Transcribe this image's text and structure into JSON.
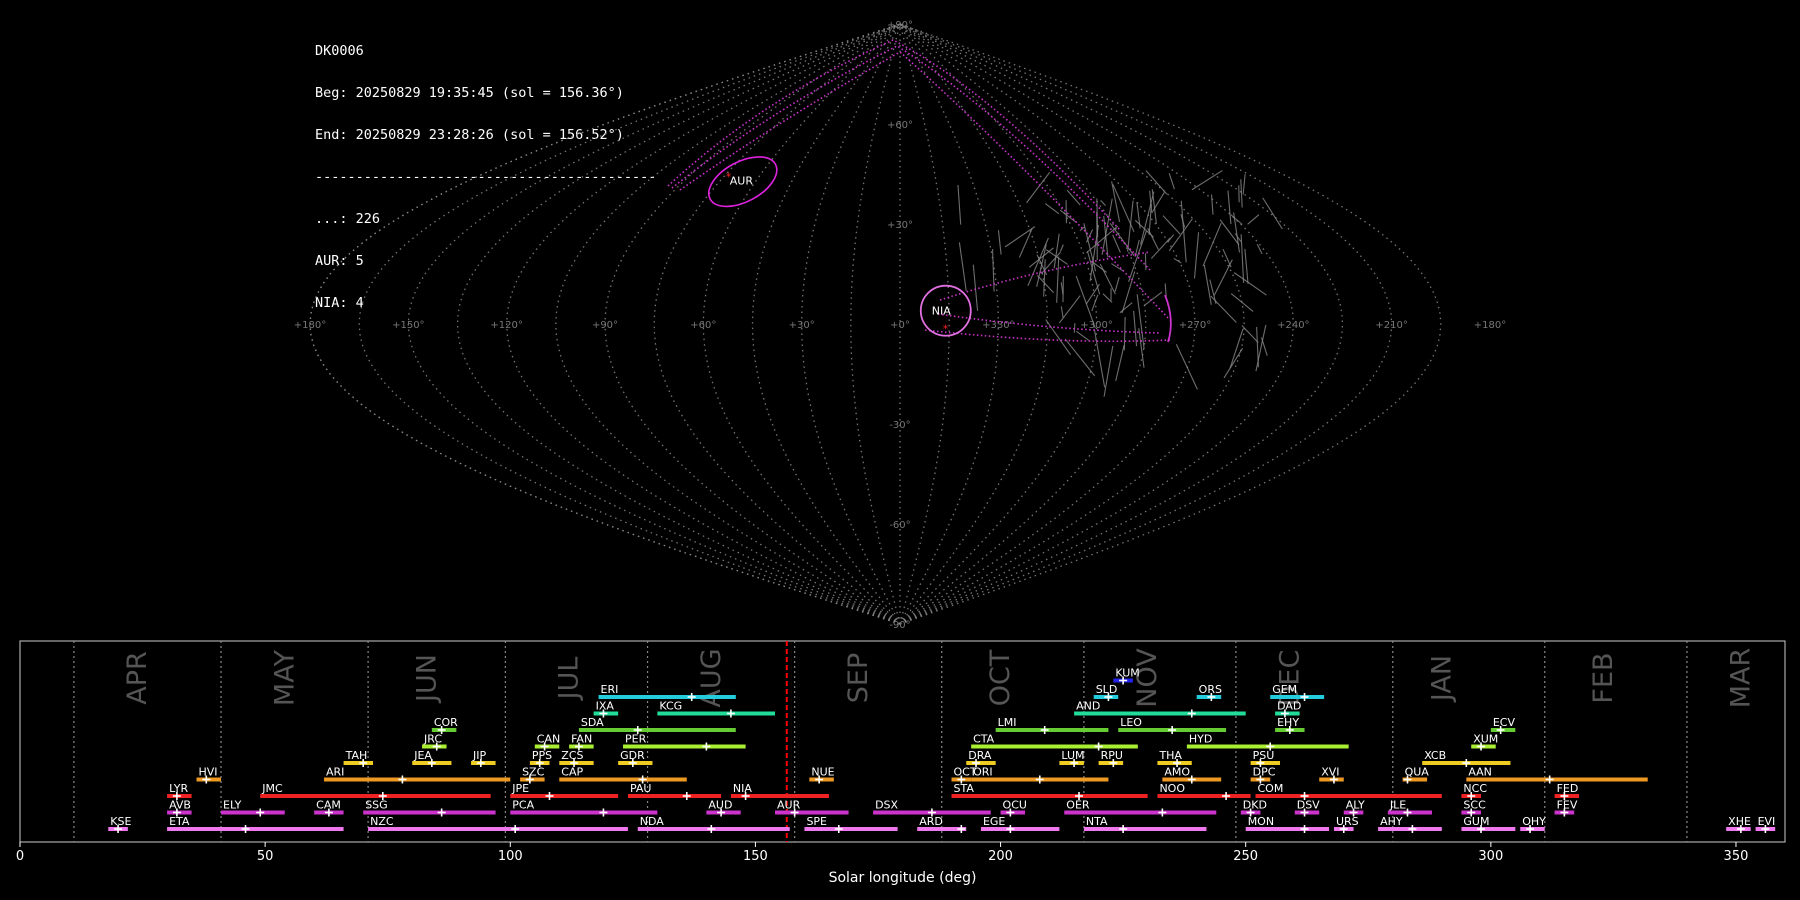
{
  "info": {
    "station": "DK0006",
    "begin": "Beg: 20250829 19:35:45 (sol = 156.36°)",
    "end": "End: 20250829 23:28:26 (sol = 156.52°)",
    "separator": "------------------------------------------",
    "counts": [
      {
        "label": "...: 226"
      },
      {
        "label": "AUR: 5"
      },
      {
        "label": "NIA: 4"
      }
    ]
  },
  "colors": {
    "background": "#000000",
    "grid": "#888888",
    "meteor_trails": "#8a8a8a",
    "shower_highlight": "#cc33cc",
    "current_sol_line": "#ff0000",
    "panel_border": "#cccccc"
  },
  "chart_data": [
    {
      "type": "scatter",
      "title": "",
      "projection": "sinusoidal sky map",
      "lat_labels": [
        "+90°",
        "+60°",
        "+30°",
        "-30°",
        "-60°",
        "-90°"
      ],
      "lon_labels": [
        "+180°",
        "+150°",
        "+120°",
        "+90°",
        "+60°",
        "+30°",
        "+0°",
        "+330°",
        "+300°",
        "+270°",
        "+240°",
        "+210°",
        "+180°"
      ],
      "radiants": [
        {
          "name": "AUR",
          "lon": 66,
          "lat": 43
        },
        {
          "name": "NIA",
          "lon": 346,
          "lat": 4
        }
      ],
      "grid": true
    },
    {
      "type": "bar",
      "title": "",
      "xlabel": "Solar longitude (deg)",
      "ylabel": "",
      "xlim": [
        0,
        360
      ],
      "xticks": [
        0,
        50,
        100,
        150,
        200,
        250,
        300,
        350
      ],
      "current_sol": 156.4,
      "grid": true,
      "months": [
        {
          "name": "APR",
          "center": 24,
          "start": 11
        },
        {
          "name": "MAY",
          "center": 54,
          "start": 41
        },
        {
          "name": "JUN",
          "center": 83,
          "start": 71
        },
        {
          "name": "JUL",
          "center": 112,
          "start": 99
        },
        {
          "name": "AUG",
          "center": 141,
          "start": 128
        },
        {
          "name": "SEP",
          "center": 171,
          "start": 158
        },
        {
          "name": "OCT",
          "center": 200,
          "start": 188
        },
        {
          "name": "NOV",
          "center": 230,
          "start": 217
        },
        {
          "name": "DEC",
          "center": 259,
          "start": 248
        },
        {
          "name": "JAN",
          "center": 290,
          "start": 280
        },
        {
          "name": "FEB",
          "center": 323,
          "start": 311
        },
        {
          "name": "MAR",
          "center": 351,
          "start": 340
        }
      ],
      "showers": [
        {
          "name": "KUM",
          "start": 223,
          "end": 227,
          "peak": 225,
          "row": 10,
          "color": "#2222ee"
        },
        {
          "name": "ERI",
          "start": 118,
          "end": 146,
          "peak": 137,
          "row": 9,
          "color": "#22ccdd"
        },
        {
          "name": "SLD",
          "start": 219,
          "end": 224,
          "peak": 222,
          "row": 9,
          "color": "#22ccdd"
        },
        {
          "name": "ORS",
          "start": 240,
          "end": 245,
          "peak": 243,
          "row": 9,
          "color": "#22ccdd"
        },
        {
          "name": "GEM",
          "start": 255,
          "end": 266,
          "peak": 262,
          "row": 9,
          "color": "#22ccdd"
        },
        {
          "name": "IXA",
          "start": 117,
          "end": 122,
          "peak": 119,
          "row": 8,
          "color": "#22dd99"
        },
        {
          "name": "KCG",
          "start": 130,
          "end": 154,
          "peak": 145,
          "row": 8,
          "color": "#22dd99"
        },
        {
          "name": "AND",
          "start": 215,
          "end": 250,
          "peak": 239,
          "row": 8,
          "color": "#22dd99"
        },
        {
          "name": "DAD",
          "start": 256,
          "end": 261,
          "peak": 258,
          "row": 8,
          "color": "#22dd99"
        },
        {
          "name": "COR",
          "start": 84,
          "end": 89,
          "peak": 86,
          "row": 7,
          "color": "#66cc33"
        },
        {
          "name": "SDA",
          "start": 114,
          "end": 146,
          "peak": 126,
          "row": 7,
          "color": "#66cc33"
        },
        {
          "name": "LMI",
          "start": 199,
          "end": 222,
          "peak": 209,
          "row": 7,
          "color": "#66cc33"
        },
        {
          "name": "LEO",
          "start": 224,
          "end": 246,
          "peak": 235,
          "row": 7,
          "color": "#66cc33"
        },
        {
          "name": "EHY",
          "start": 256,
          "end": 262,
          "peak": 259,
          "row": 7,
          "color": "#66cc33"
        },
        {
          "name": "ECV",
          "start": 300,
          "end": 305,
          "peak": 302,
          "row": 7,
          "color": "#66cc33"
        },
        {
          "name": "JRC",
          "start": 82,
          "end": 87,
          "peak": 85,
          "row": 6,
          "color": "#aaee33"
        },
        {
          "name": "CAN",
          "start": 105,
          "end": 110,
          "peak": 107,
          "row": 6,
          "color": "#aaee33"
        },
        {
          "name": "FAN",
          "start": 112,
          "end": 117,
          "peak": 114,
          "row": 6,
          "color": "#aaee33"
        },
        {
          "name": "PER",
          "start": 123,
          "end": 148,
          "peak": 140,
          "row": 6,
          "color": "#aaee33"
        },
        {
          "name": "CTA",
          "start": 194,
          "end": 228,
          "peak": 220,
          "row": 6,
          "color": "#aaee33"
        },
        {
          "name": "HYD",
          "start": 238,
          "end": 271,
          "peak": 255,
          "row": 6,
          "color": "#aaee33"
        },
        {
          "name": "XUM",
          "start": 296,
          "end": 301,
          "peak": 298,
          "row": 6,
          "color": "#aaee33"
        },
        {
          "name": "TAH",
          "start": 66,
          "end": 72,
          "peak": 70,
          "row": 5,
          "color": "#eecc22"
        },
        {
          "name": "JEA",
          "start": 80,
          "end": 88,
          "peak": 84,
          "row": 5,
          "color": "#eecc22"
        },
        {
          "name": "JIP",
          "start": 92,
          "end": 97,
          "peak": 94,
          "row": 5,
          "color": "#eecc22"
        },
        {
          "name": "PPS",
          "start": 104,
          "end": 108,
          "peak": 106,
          "row": 5,
          "color": "#eecc22"
        },
        {
          "name": "ZCS",
          "start": 110,
          "end": 117,
          "peak": 113,
          "row": 5,
          "color": "#eecc22"
        },
        {
          "name": "GDR",
          "start": 122,
          "end": 129,
          "peak": 125,
          "row": 5,
          "color": "#eecc22"
        },
        {
          "name": "DRA",
          "start": 193,
          "end": 199,
          "peak": 195,
          "row": 5,
          "color": "#eecc22"
        },
        {
          "name": "LUM",
          "start": 212,
          "end": 217,
          "peak": 215,
          "row": 5,
          "color": "#eecc22"
        },
        {
          "name": "RPU",
          "start": 220,
          "end": 225,
          "peak": 223,
          "row": 5,
          "color": "#eecc22"
        },
        {
          "name": "THA",
          "start": 232,
          "end": 239,
          "peak": 236,
          "row": 5,
          "color": "#eecc22"
        },
        {
          "name": "PSU",
          "start": 251,
          "end": 257,
          "peak": 253,
          "row": 5,
          "color": "#eecc22"
        },
        {
          "name": "XCB",
          "start": 286,
          "end": 304,
          "peak": 295,
          "row": 5,
          "color": "#eecc22"
        },
        {
          "name": "HVI",
          "start": 36,
          "end": 41,
          "peak": 38,
          "row": 4,
          "color": "#ee9922"
        },
        {
          "name": "ARI",
          "start": 62,
          "end": 100,
          "peak": 78,
          "row": 4,
          "color": "#ee9922"
        },
        {
          "name": "SZC",
          "start": 102,
          "end": 107,
          "peak": 104,
          "row": 4,
          "color": "#ee9922"
        },
        {
          "name": "CAP",
          "start": 110,
          "end": 136,
          "peak": 127,
          "row": 4,
          "color": "#ee9922"
        },
        {
          "name": "NUE",
          "start": 161,
          "end": 166,
          "peak": 163,
          "row": 4,
          "color": "#ee9922"
        },
        {
          "name": "OCT",
          "start": 190,
          "end": 194,
          "peak": 192,
          "row": 4,
          "color": "#ee9922"
        },
        {
          "name": "ORI",
          "start": 194,
          "end": 222,
          "peak": 208,
          "row": 4,
          "color": "#ee9922"
        },
        {
          "name": "AMO",
          "start": 233,
          "end": 245,
          "peak": 239,
          "row": 4,
          "color": "#ee9922"
        },
        {
          "name": "DPC",
          "start": 251,
          "end": 255,
          "peak": 253,
          "row": 4,
          "color": "#ee9922"
        },
        {
          "name": "XVI",
          "start": 265,
          "end": 270,
          "peak": 268,
          "row": 4,
          "color": "#ee9922"
        },
        {
          "name": "QUA",
          "start": 282,
          "end": 287,
          "peak": 283,
          "row": 4,
          "color": "#ee9922"
        },
        {
          "name": "AAN",
          "start": 295,
          "end": 332,
          "peak": 312,
          "row": 4,
          "color": "#ee9922"
        },
        {
          "name": "LYR",
          "start": 30,
          "end": 35,
          "peak": 32,
          "row": 3,
          "color": "#ee2222"
        },
        {
          "name": "JMC",
          "start": 49,
          "end": 96,
          "peak": 74,
          "row": 3,
          "color": "#ee2222"
        },
        {
          "name": "JPE",
          "start": 100,
          "end": 122,
          "peak": 108,
          "row": 3,
          "color": "#ee2222"
        },
        {
          "name": "PAU",
          "start": 124,
          "end": 143,
          "peak": 136,
          "row": 3,
          "color": "#ee2222"
        },
        {
          "name": "NIA",
          "start": 145,
          "end": 165,
          "peak": 148,
          "row": 3,
          "color": "#ee2222"
        },
        {
          "name": "STA",
          "start": 190,
          "end": 230,
          "peak": 216,
          "row": 3,
          "color": "#ee2222"
        },
        {
          "name": "NOO",
          "start": 232,
          "end": 251,
          "peak": 246,
          "row": 3,
          "color": "#ee2222"
        },
        {
          "name": "COM",
          "start": 252,
          "end": 290,
          "peak": 262,
          "row": 3,
          "color": "#ee2222"
        },
        {
          "name": "NCC",
          "start": 294,
          "end": 298,
          "peak": 296,
          "row": 3,
          "color": "#ee2222"
        },
        {
          "name": "FED",
          "start": 313,
          "end": 318,
          "peak": 315,
          "row": 3,
          "color": "#ee2222"
        },
        {
          "name": "AVB",
          "start": 30,
          "end": 35,
          "peak": 32,
          "row": 2,
          "color": "#cc33cc"
        },
        {
          "name": "ELY",
          "start": 41,
          "end": 54,
          "peak": 49,
          "row": 2,
          "color": "#cc33cc"
        },
        {
          "name": "CAM",
          "start": 60,
          "end": 66,
          "peak": 63,
          "row": 2,
          "color": "#cc33cc"
        },
        {
          "name": "SSG",
          "start": 70,
          "end": 97,
          "peak": 86,
          "row": 2,
          "color": "#cc33cc"
        },
        {
          "name": "PCA",
          "start": 100,
          "end": 130,
          "peak": 119,
          "row": 2,
          "color": "#cc33cc"
        },
        {
          "name": "AUD",
          "start": 140,
          "end": 147,
          "peak": 143,
          "row": 2,
          "color": "#cc33cc"
        },
        {
          "name": "AUR",
          "start": 154,
          "end": 169,
          "peak": 158,
          "row": 2,
          "color": "#cc33cc"
        },
        {
          "name": "DSX",
          "start": 174,
          "end": 198,
          "peak": 186,
          "row": 2,
          "color": "#cc33cc"
        },
        {
          "name": "OCU",
          "start": 200,
          "end": 205,
          "peak": 202,
          "row": 2,
          "color": "#cc33cc"
        },
        {
          "name": "OER",
          "start": 213,
          "end": 244,
          "peak": 233,
          "row": 2,
          "color": "#cc33cc"
        },
        {
          "name": "DKD",
          "start": 249,
          "end": 253,
          "peak": 251,
          "row": 2,
          "color": "#cc33cc"
        },
        {
          "name": "DSV",
          "start": 260,
          "end": 265,
          "peak": 262,
          "row": 2,
          "color": "#cc33cc"
        },
        {
          "name": "ALY",
          "start": 270,
          "end": 274,
          "peak": 272,
          "row": 2,
          "color": "#cc33cc"
        },
        {
          "name": "JLE",
          "start": 279,
          "end": 288,
          "peak": 283,
          "row": 2,
          "color": "#cc33cc"
        },
        {
          "name": "SCC",
          "start": 294,
          "end": 298,
          "peak": 296,
          "row": 2,
          "color": "#cc33cc"
        },
        {
          "name": "FEV",
          "start": 313,
          "end": 317,
          "peak": 315,
          "row": 2,
          "color": "#cc33cc"
        },
        {
          "name": "KSE",
          "start": 18,
          "end": 22,
          "peak": 20,
          "row": 1,
          "color": "#ee77ee"
        },
        {
          "name": "ETA",
          "start": 30,
          "end": 66,
          "peak": 46,
          "row": 1,
          "color": "#ee77ee"
        },
        {
          "name": "NZC",
          "start": 71,
          "end": 124,
          "peak": 101,
          "row": 1,
          "color": "#ee77ee"
        },
        {
          "name": "NDA",
          "start": 126,
          "end": 157,
          "peak": 141,
          "row": 1,
          "color": "#ee77ee"
        },
        {
          "name": "SPE",
          "start": 160,
          "end": 179,
          "peak": 167,
          "row": 1,
          "color": "#ee77ee"
        },
        {
          "name": "ARD",
          "start": 183,
          "end": 193,
          "peak": 192,
          "row": 1,
          "color": "#ee77ee"
        },
        {
          "name": "EGE",
          "start": 196,
          "end": 212,
          "peak": 202,
          "row": 1,
          "color": "#ee77ee"
        },
        {
          "name": "NTA",
          "start": 217,
          "end": 242,
          "peak": 225,
          "row": 1,
          "color": "#ee77ee"
        },
        {
          "name": "MON",
          "start": 250,
          "end": 267,
          "peak": 262,
          "row": 1,
          "color": "#ee77ee"
        },
        {
          "name": "URS",
          "start": 268,
          "end": 272,
          "peak": 270,
          "row": 1,
          "color": "#ee77ee"
        },
        {
          "name": "AHY",
          "start": 277,
          "end": 290,
          "peak": 284,
          "row": 1,
          "color": "#ee77ee"
        },
        {
          "name": "GUM",
          "start": 294,
          "end": 305,
          "peak": 298,
          "row": 1,
          "color": "#ee77ee"
        },
        {
          "name": "OHY",
          "start": 306,
          "end": 311,
          "peak": 308,
          "row": 1,
          "color": "#ee77ee"
        },
        {
          "name": "XHE",
          "start": 348,
          "end": 353,
          "peak": 351,
          "row": 1,
          "color": "#ee77ee"
        },
        {
          "name": "EVI",
          "start": 354,
          "end": 358,
          "peak": 356,
          "row": 1,
          "color": "#ee77ee"
        }
      ]
    }
  ]
}
